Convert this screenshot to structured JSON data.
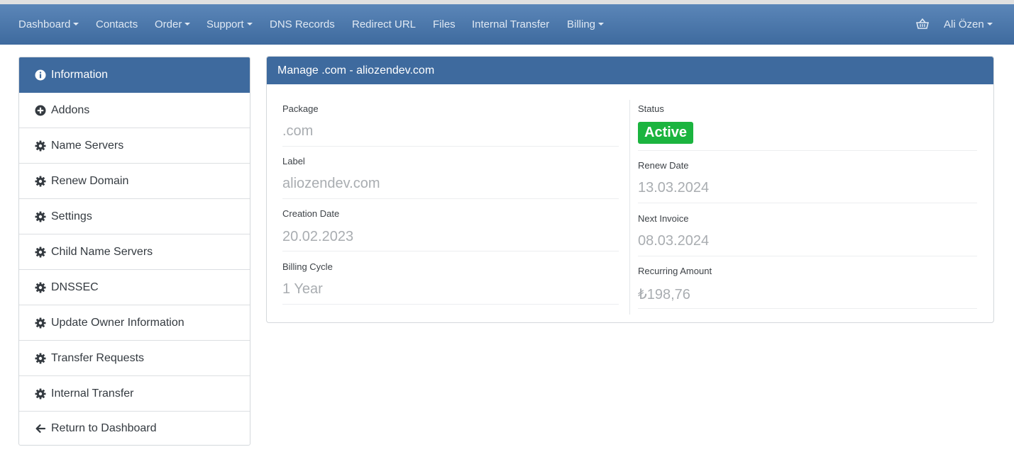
{
  "nav": {
    "dashboard": "Dashboard",
    "contacts": "Contacts",
    "order": "Order",
    "support": "Support",
    "dns_records": "DNS Records",
    "redirect_url": "Redirect URL",
    "files": "Files",
    "internal_transfer": "Internal Transfer",
    "billing": "Billing",
    "user": "Ali Özen",
    "cart_icon": "basket-icon"
  },
  "sidebar": {
    "items": [
      {
        "label": "Information",
        "icon": "info-circle-icon",
        "active": true
      },
      {
        "label": "Addons",
        "icon": "plus-circle-icon"
      },
      {
        "label": "Name Servers",
        "icon": "gear-icon"
      },
      {
        "label": "Renew Domain",
        "icon": "gear-icon"
      },
      {
        "label": "Settings",
        "icon": "gear-icon"
      },
      {
        "label": "Child Name Servers",
        "icon": "gear-icon"
      },
      {
        "label": "DNSSEC",
        "icon": "gear-icon"
      },
      {
        "label": "Update Owner Information",
        "icon": "gear-icon"
      },
      {
        "label": "Transfer Requests",
        "icon": "gear-icon"
      },
      {
        "label": "Internal Transfer",
        "icon": "gear-icon"
      },
      {
        "label": "Return to Dashboard",
        "icon": "arrow-left-icon"
      }
    ]
  },
  "panel": {
    "title": "Manage .com - aliozendev.com",
    "left": [
      {
        "label": "Package",
        "value": ".com"
      },
      {
        "label": "Label",
        "value": "aliozendev.com"
      },
      {
        "label": "Creation Date",
        "value": "20.02.2023"
      },
      {
        "label": "Billing Cycle",
        "value": "1 Year"
      }
    ],
    "right": {
      "status_label": "Status",
      "status_value": "Active",
      "fields": [
        {
          "label": "Renew Date",
          "value": "13.03.2024"
        },
        {
          "label": "Next Invoice",
          "value": "08.03.2024"
        },
        {
          "label": "Recurring Amount",
          "value": "₺198,76"
        }
      ]
    }
  },
  "colors": {
    "navbar": "#3e6a9e",
    "active_item": "#3e6a9e",
    "status_active": "#1bb43f"
  }
}
